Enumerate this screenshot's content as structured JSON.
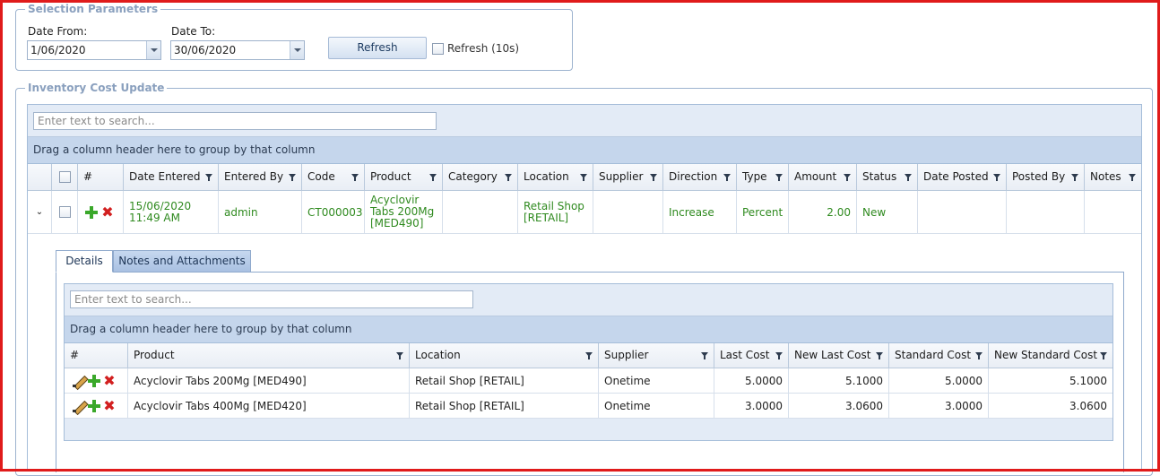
{
  "selection": {
    "legend": "Selection Parameters",
    "date_from_label": "Date From:",
    "date_from": "1/06/2020",
    "date_to_label": "Date To:",
    "date_to": "30/06/2020",
    "refresh_button": "Refresh",
    "auto_refresh_label": "Refresh (10s)"
  },
  "inventory": {
    "legend": "Inventory Cost Update",
    "search_placeholder": "Enter text to search...",
    "group_hint": "Drag a column header here to group by that column",
    "columns": [
      "#",
      "Date Entered",
      "Entered By",
      "Code",
      "Product",
      "Category",
      "Location",
      "Supplier",
      "Direction",
      "Type",
      "Amount",
      "Status",
      "Date Posted",
      "Posted By",
      "Notes"
    ],
    "row": {
      "date_entered_1": "15/06/2020",
      "date_entered_2": "11:49 AM",
      "entered_by": "admin",
      "code": "CT000003",
      "product_1": "Acyclovir",
      "product_2": "Tabs 200Mg",
      "product_3": "[MED490]",
      "category": "",
      "location_1": "Retail Shop",
      "location_2": "[RETAIL]",
      "supplier": "",
      "direction": "Increase",
      "type": "Percent",
      "amount": "2.00",
      "status": "New",
      "date_posted": "",
      "posted_by": "",
      "notes": ""
    }
  },
  "detail": {
    "tabs": [
      "Details",
      "Notes and Attachments"
    ],
    "search_placeholder": "Enter text to search...",
    "group_hint": "Drag a column header here to group by that column",
    "columns": [
      "#",
      "Product",
      "Location",
      "Supplier",
      "Last Cost",
      "New Last Cost",
      "Standard Cost",
      "New Standard Cost"
    ],
    "rows": [
      {
        "product": "Acyclovir Tabs 200Mg [MED490]",
        "location": "Retail Shop [RETAIL]",
        "supplier": "Onetime",
        "last_cost": "5.0000",
        "new_last_cost": "5.1000",
        "standard_cost": "5.0000",
        "new_standard_cost": "5.1000"
      },
      {
        "product": "Acyclovir Tabs 400Mg [MED420]",
        "location": "Retail Shop [RETAIL]",
        "supplier": "Onetime",
        "last_cost": "3.0000",
        "new_last_cost": "3.0600",
        "standard_cost": "3.0000",
        "new_standard_cost": "3.0600"
      }
    ]
  },
  "colors": {
    "accent": "#e01b1b",
    "green_text": "#2f8a1f",
    "header_blue": "#c5d6ec"
  }
}
